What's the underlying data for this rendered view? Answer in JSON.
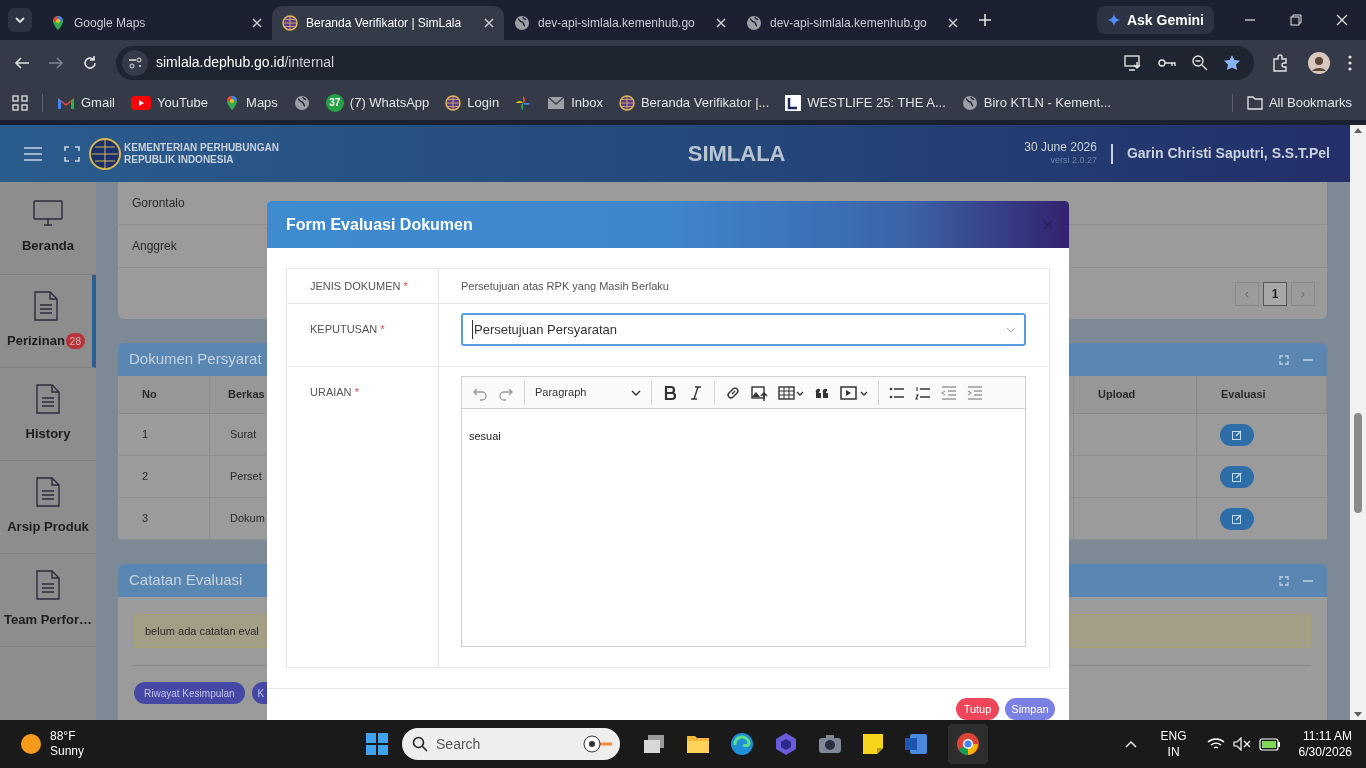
{
  "browser": {
    "tabs": [
      {
        "title": "Google Maps",
        "selected": false
      },
      {
        "title": "Beranda Verifikator | SimLala",
        "selected": true
      },
      {
        "title": "dev-api-simlala.kemenhub.go",
        "selected": false
      },
      {
        "title": "dev-api-simlala.kemenhub.go",
        "selected": false
      }
    ],
    "ask_gemini": "Ask Gemini",
    "address": {
      "host": "simlala.dephub.go.id",
      "path": "/internal"
    },
    "bookmarks": [
      {
        "label": "Gmail"
      },
      {
        "label": "YouTube"
      },
      {
        "label": "Maps"
      },
      {
        "label": "(7) WhatsApp",
        "badge": "37"
      },
      {
        "label": "Login"
      },
      {
        "label": "Inbox"
      },
      {
        "label": "Beranda Verifikator |..."
      },
      {
        "label": "WESTLIFE 25: THE A..."
      },
      {
        "label": "Biro KTLN - Kement..."
      }
    ],
    "all_bookmarks": "All Bookmarks"
  },
  "app_header": {
    "org": [
      "KEMENTERIAN PERHUBUNGAN",
      "REPUBLIK INDONESIA"
    ],
    "title": "SIMLALA",
    "date": "30 June 2026",
    "version": "versi 2.0.27",
    "user": "Garin Christi Saputri, S.S.T.Pel"
  },
  "sidebar": {
    "items": [
      {
        "label": "Beranda",
        "selected": false
      },
      {
        "label": "Perizinan",
        "selected": true,
        "badge": "28"
      },
      {
        "label": "History",
        "selected": false
      },
      {
        "label": "Arsip Produk",
        "selected": false
      },
      {
        "label": "Team Perfor…",
        "selected": false
      }
    ]
  },
  "location_rows": [
    "Gorontalo",
    "Anggrek"
  ],
  "pagination": {
    "prev": "‹",
    "pages": [
      {
        "label": "1",
        "selected": true
      }
    ],
    "next": "›"
  },
  "documents_panel": {
    "title": "Dokumen Persyarat",
    "columns": [
      "No",
      "Berkas",
      "Upload",
      "Evaluasi"
    ],
    "rows": [
      {
        "no": "1",
        "berkas": "Surat"
      },
      {
        "no": "2",
        "berkas": "Perset"
      },
      {
        "no": "3",
        "berkas": "Dokum"
      }
    ]
  },
  "notes_panel": {
    "title": "Catatan Evaluasi",
    "message": "belum ada catatan eval",
    "buttons": [
      "Riwayat Kesimpulan",
      "K"
    ]
  },
  "modal": {
    "title": "Form Evaluasi Dokumen",
    "fields": [
      {
        "kind": "text",
        "label": "JENIS DOKUMEN",
        "required_mark": "*",
        "value": "Persetujuan atas RPK yang Masih Berlaku"
      },
      {
        "kind": "select",
        "label": "KEPUTUSAN",
        "required_mark": "*",
        "value": "Persetujuan Persyaratan"
      },
      {
        "kind": "editor",
        "label": "URAIAN",
        "required_mark": "*",
        "block_format": "Paragraph",
        "content": "sesuai"
      }
    ],
    "buttons": [
      {
        "label": "Tutup",
        "kind": "danger"
      },
      {
        "label": "Simpan",
        "kind": "primary"
      }
    ]
  },
  "taskbar": {
    "weather": {
      "temp": "88°F",
      "condition": "Sunny"
    },
    "search_placeholder": "Search",
    "language": [
      "ENG",
      "IN"
    ],
    "time": "11:11 AM",
    "date": "6/30/2026"
  }
}
